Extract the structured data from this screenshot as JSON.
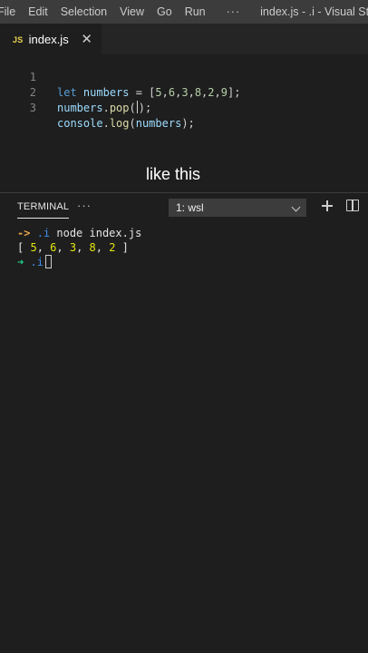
{
  "menu": {
    "items": [
      "File",
      "Edit",
      "Selection",
      "View",
      "Go",
      "Run"
    ],
    "more": "···",
    "window_title": "index.js - .i - Visual St..."
  },
  "tab": {
    "icon_text": "JS",
    "label": "index.js",
    "close": "✕"
  },
  "editor": {
    "lines": [
      {
        "number": "1",
        "text": "let numbers = [5,6,3,8,2,9];"
      },
      {
        "number": "2",
        "text": "numbers.pop();"
      },
      {
        "number": "3",
        "text": "console.log(numbers);"
      }
    ],
    "tokens": {
      "l1": {
        "kw": "let",
        "var": "numbers",
        "eq": " = [",
        "nums": [
          "5",
          "6",
          "3",
          "8",
          "2",
          "9"
        ],
        "end": "];"
      },
      "l2": {
        "obj": "numbers",
        "dot": ".",
        "fn_a": "pop",
        "fn_b": "(",
        "rest": ");"
      },
      "l3": {
        "obj": "console",
        "dot": ".",
        "fn": "log",
        "open": "(",
        "arg": "numbers",
        "close": ");"
      }
    }
  },
  "caption": "like this",
  "panel": {
    "tab_label": "TERMINAL",
    "more": "···",
    "terminal_select": "1: wsl"
  },
  "terminal": {
    "prompt1_arrow": "->",
    "prompt1_dir": ".i",
    "prompt1_cmd": "node index.js",
    "output": "[ 5, 6, 3, 8, 2 ]",
    "output_parts": {
      "open": "[ ",
      "values": [
        "5",
        "6",
        "3",
        "8",
        "2"
      ],
      "close": " ]"
    },
    "prompt2_arrow": "➜",
    "prompt2_dir": ".i"
  },
  "colors": {
    "keyword": "#569cd6",
    "variable": "#9cdcfe",
    "number": "#b5cea8",
    "function": "#dcdcaa",
    "prompt_orange": "#e5a54b",
    "prompt_green": "#23d18b",
    "dir_blue": "#3b8eea",
    "output_yellow": "#e5e510"
  }
}
